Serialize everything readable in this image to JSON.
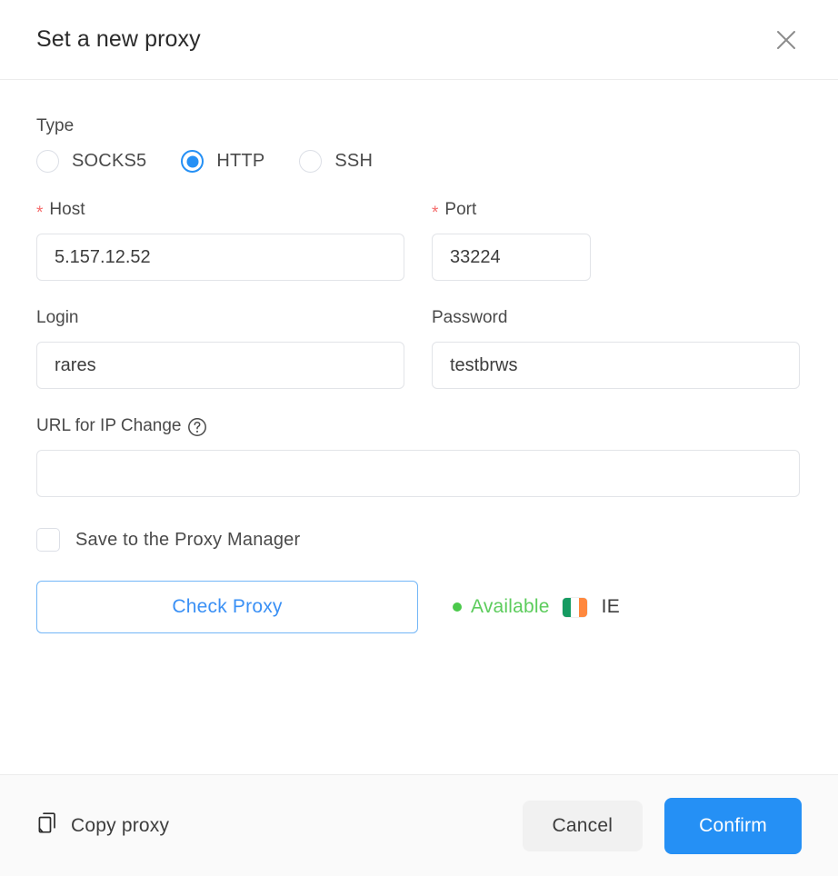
{
  "dialog": {
    "title": "Set a new proxy",
    "close_icon": "close-icon"
  },
  "type_section": {
    "label": "Type",
    "options": [
      {
        "label": "SOCKS5",
        "selected": false
      },
      {
        "label": "HTTP",
        "selected": true
      },
      {
        "label": "SSH",
        "selected": false
      }
    ]
  },
  "host": {
    "label": "Host",
    "required_marker": "*",
    "value": "5.157.12.52",
    "placeholder": ""
  },
  "port": {
    "label": "Port",
    "required_marker": "*",
    "value": "33224",
    "placeholder": ""
  },
  "login": {
    "label": "Login",
    "value": "rares",
    "placeholder": ""
  },
  "password": {
    "label": "Password",
    "value": "testbrws",
    "placeholder": ""
  },
  "url_ip_change": {
    "label": "URL for IP Change",
    "help_icon": "help-circle-icon",
    "value": "",
    "placeholder": ""
  },
  "save_proxy_manager": {
    "label": "Save to the Proxy Manager",
    "checked": false
  },
  "check_proxy": {
    "button_label": "Check Proxy",
    "status_text": "Available",
    "status_color": "#5ccc5c",
    "country_code": "IE",
    "flag_icon": "ireland-flag-icon"
  },
  "footer": {
    "copy_icon": "copy-icon",
    "copy_label": "Copy proxy",
    "cancel_label": "Cancel",
    "confirm_label": "Confirm"
  },
  "colors": {
    "accent": "#2590f5",
    "required": "#f56c6c",
    "success": "#5ccc5c"
  }
}
